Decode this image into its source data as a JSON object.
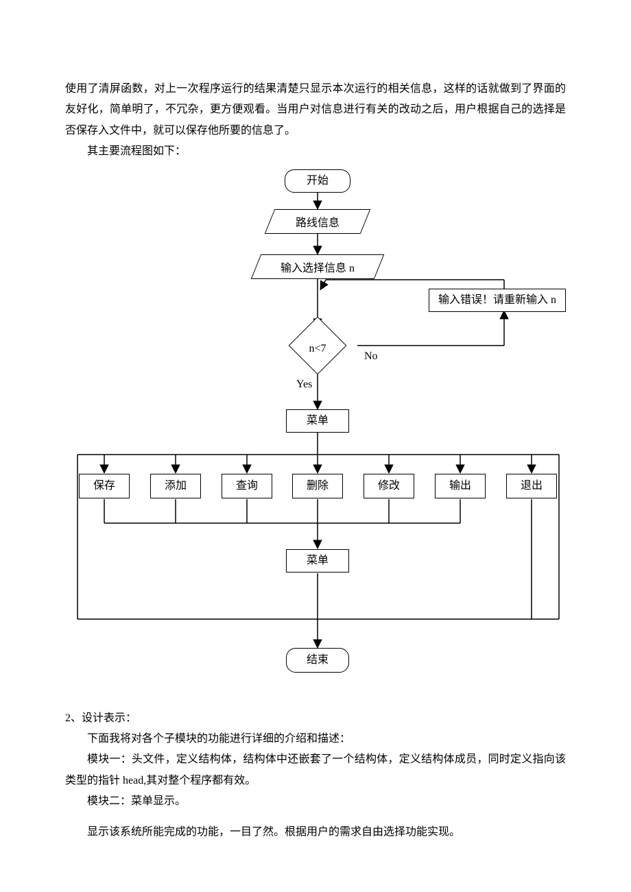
{
  "intro_para": "使用了清屏函数，对上一次程序运行的结果清楚只显示本次运行的相关信息，这样的话就做到了界面的友好化，简单明了，不冗杂，更方便观看。当用户对信息进行有关的改动之后，用户根据自己的选择是否保存入文件中，就可以保存他所要的信息了。",
  "flow_intro": "其主要流程图如下：",
  "flowchart": {
    "start": "开始",
    "route_info": "路线信息",
    "input_select": "输入选择信息 n",
    "input_error": "输入错误！请重新输入 n",
    "decision": "n<7",
    "no_label": "No",
    "yes_label": "Yes",
    "menu1": "菜单",
    "opt_save": "保存",
    "opt_add": "添加",
    "opt_query": "查询",
    "opt_delete": "删除",
    "opt_modify": "修改",
    "opt_output": "输出",
    "opt_exit": "退出",
    "menu2": "菜单",
    "end": "结束"
  },
  "section2_heading": "2、设计表示：",
  "section2_p1": "下面我将对各个子模块的功能进行详细的介绍和描述：",
  "section2_p2": "模块一：头文件，定义结构体，结构体中还嵌套了一个结构体，定义结构体成员，同时定义指向该类型的指针 head,其对整个程序都有效。",
  "section2_p3": "模块二：菜单显示。",
  "section2_p4": "显示该系统所能完成的功能，一目了然。根据用户的需求自由选择功能实现。"
}
